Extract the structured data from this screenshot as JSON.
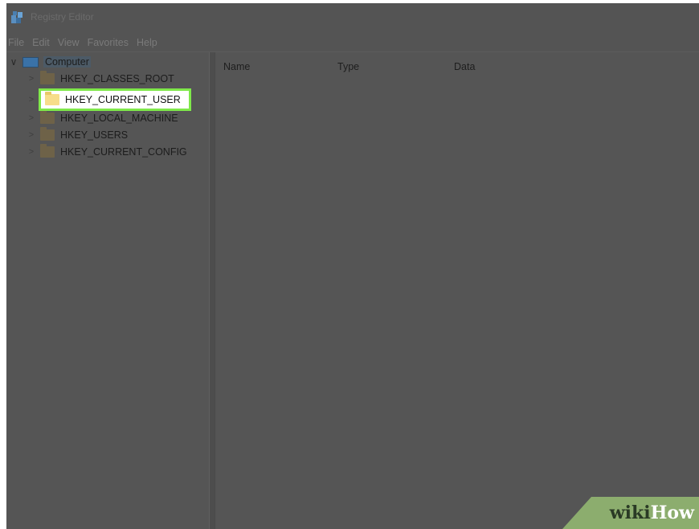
{
  "window": {
    "title": "Registry Editor"
  },
  "menu": {
    "items": [
      "File",
      "Edit",
      "View",
      "Favorites",
      "Help"
    ]
  },
  "tree": {
    "root_label": "Computer",
    "nodes": [
      {
        "label": "HKEY_CLASSES_ROOT"
      },
      {
        "label": "HKEY_CURRENT_USER"
      },
      {
        "label": "HKEY_LOCAL_MACHINE"
      },
      {
        "label": "HKEY_USERS"
      },
      {
        "label": "HKEY_CURRENT_CONFIG"
      }
    ],
    "selected_node": "HKEY_CURRENT_USER"
  },
  "list": {
    "columns": [
      "Name",
      "Type",
      "Data"
    ]
  },
  "watermark": {
    "wiki": "wiki",
    "how": "How"
  },
  "colors": {
    "highlight_border": "#7fe84a",
    "watermark_bg": "#8cad6e"
  }
}
